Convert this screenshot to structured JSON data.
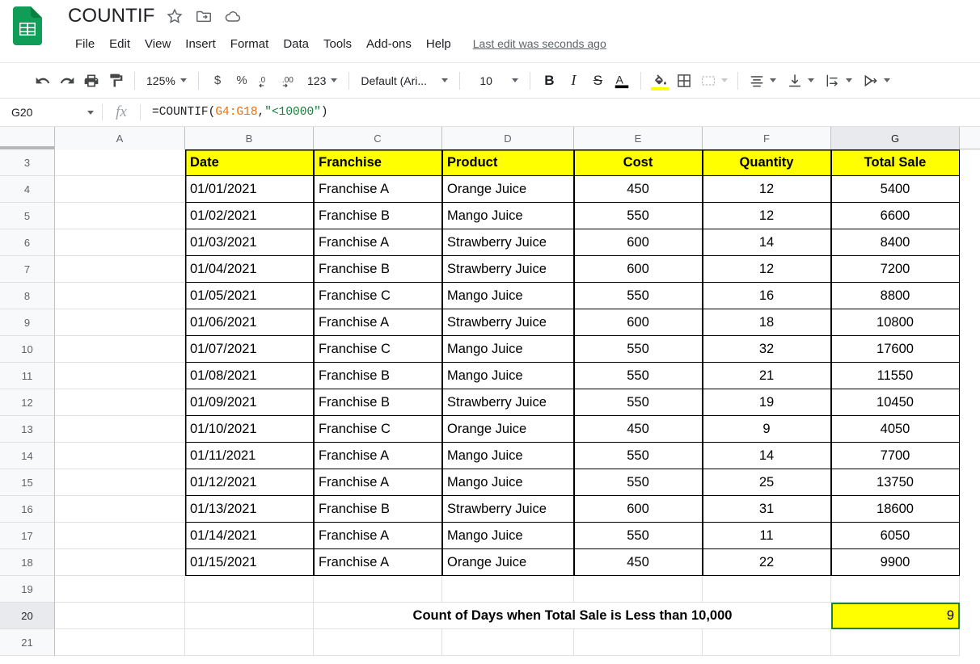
{
  "app": {
    "logo_icon": "sheets-logo-icon",
    "doc_title": "COUNTIF",
    "title_icons": [
      {
        "name": "star-icon",
        "label": "Star"
      },
      {
        "name": "move-to-folder-icon",
        "label": "Move to folder"
      },
      {
        "name": "cloud-saved-icon",
        "label": "Saved to Drive"
      }
    ],
    "menus": [
      "File",
      "Edit",
      "View",
      "Insert",
      "Format",
      "Data",
      "Tools",
      "Add-ons",
      "Help"
    ],
    "last_edit": "Last edit was seconds ago"
  },
  "toolbar": {
    "undo": "undo-icon",
    "redo": "redo-icon",
    "print": "print-icon",
    "paint_format": "paint-format-icon",
    "zoom": "125%",
    "currency": "$",
    "percent": "%",
    "decrease_decimal": ".0",
    "increase_decimal": ".00",
    "number_format": "123",
    "font": "Default (Ari...",
    "font_size": "10",
    "bold": "B",
    "italic": "I",
    "strikethrough": "S",
    "text_color": "A",
    "fill_color": "fill-color-icon",
    "fill_color_swatch": "#ffff00",
    "borders": "borders-icon",
    "merge_cells": "merge-cells-icon",
    "horizontal_align": "horizontal-align-icon",
    "vertical_align": "vertical-align-icon",
    "text_wrap": "text-wrap-icon",
    "text_rotation": "text-rotation-icon"
  },
  "formula_bar": {
    "name_box": "G20",
    "fx_label": "fx",
    "formula_prefix": "=COUNTIF(",
    "formula_range": "G4:G18",
    "formula_comma": ",",
    "formula_criteria": "\"<10000\"",
    "formula_suffix": ")"
  },
  "grid": {
    "columns": [
      "A",
      "B",
      "C",
      "D",
      "E",
      "F",
      "G"
    ],
    "active_column": "G",
    "active_row": "20",
    "rows": [
      "3",
      "4",
      "5",
      "6",
      "7",
      "8",
      "9",
      "10",
      "11",
      "12",
      "13",
      "14",
      "15",
      "16",
      "17",
      "18",
      "19",
      "20",
      "21"
    ],
    "table_headers": [
      "Date",
      "Franchise",
      "Product",
      "Cost",
      "Quantity",
      "Total Sale"
    ],
    "table_rows": [
      {
        "date": "01/01/2021",
        "franchise": "Franchise A",
        "product": "Orange Juice",
        "cost": "450",
        "quantity": "12",
        "total_sale": "5400"
      },
      {
        "date": "01/02/2021",
        "franchise": "Franchise B",
        "product": "Mango Juice",
        "cost": "550",
        "quantity": "12",
        "total_sale": "6600"
      },
      {
        "date": "01/03/2021",
        "franchise": "Franchise A",
        "product": "Strawberry Juice",
        "cost": "600",
        "quantity": "14",
        "total_sale": "8400"
      },
      {
        "date": "01/04/2021",
        "franchise": "Franchise B",
        "product": "Strawberry Juice",
        "cost": "600",
        "quantity": "12",
        "total_sale": "7200"
      },
      {
        "date": "01/05/2021",
        "franchise": "Franchise C",
        "product": "Mango Juice",
        "cost": "550",
        "quantity": "16",
        "total_sale": "8800"
      },
      {
        "date": "01/06/2021",
        "franchise": "Franchise A",
        "product": "Strawberry Juice",
        "cost": "600",
        "quantity": "18",
        "total_sale": "10800"
      },
      {
        "date": "01/07/2021",
        "franchise": "Franchise C",
        "product": "Mango Juice",
        "cost": "550",
        "quantity": "32",
        "total_sale": "17600"
      },
      {
        "date": "01/08/2021",
        "franchise": "Franchise B",
        "product": "Mango Juice",
        "cost": "550",
        "quantity": "21",
        "total_sale": "11550"
      },
      {
        "date": "01/09/2021",
        "franchise": "Franchise B",
        "product": "Strawberry Juice",
        "cost": "550",
        "quantity": "19",
        "total_sale": "10450"
      },
      {
        "date": "01/10/2021",
        "franchise": "Franchise C",
        "product": "Orange Juice",
        "cost": "450",
        "quantity": "9",
        "total_sale": "4050"
      },
      {
        "date": "01/11/2021",
        "franchise": "Franchise A",
        "product": "Mango Juice",
        "cost": "550",
        "quantity": "14",
        "total_sale": "7700"
      },
      {
        "date": "01/12/2021",
        "franchise": "Franchise A",
        "product": "Mango Juice",
        "cost": "550",
        "quantity": "25",
        "total_sale": "13750"
      },
      {
        "date": "01/13/2021",
        "franchise": "Franchise B",
        "product": "Strawberry Juice",
        "cost": "600",
        "quantity": "31",
        "total_sale": "18600"
      },
      {
        "date": "01/14/2021",
        "franchise": "Franchise A",
        "product": "Mango Juice",
        "cost": "550",
        "quantity": "11",
        "total_sale": "6050"
      },
      {
        "date": "01/15/2021",
        "franchise": "Franchise A",
        "product": "Orange Juice",
        "cost": "450",
        "quantity": "22",
        "total_sale": "9900"
      }
    ],
    "result_label": "Count of Days when Total Sale is Less than 10,000",
    "result_value": "9",
    "selection_fill": "#ffff00",
    "selection_border": "#1f7a4d",
    "selection_handle": "#1a73e8"
  }
}
